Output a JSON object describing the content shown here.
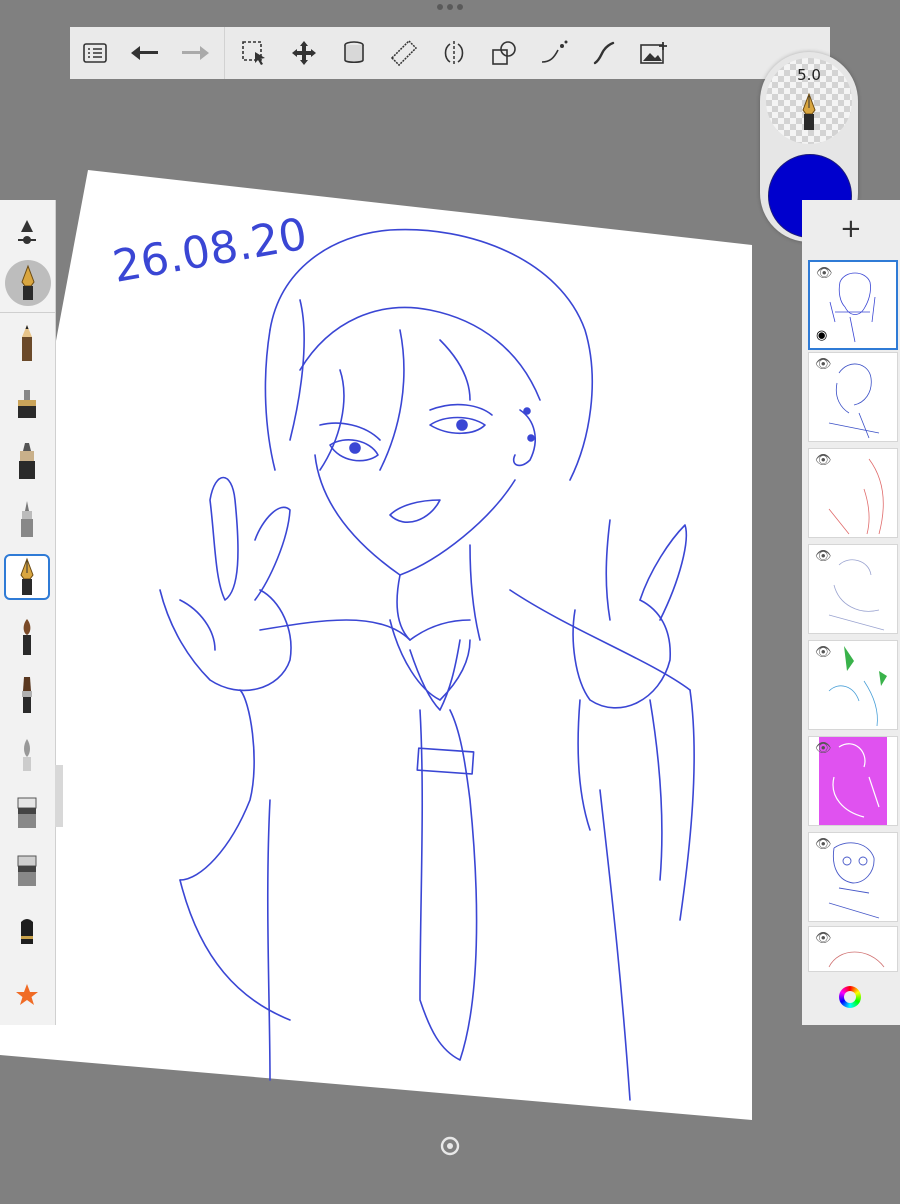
{
  "app": {
    "toolbar": {
      "items": [
        {
          "name": "list-menu-icon"
        },
        {
          "name": "undo-icon"
        },
        {
          "name": "redo-icon"
        },
        {
          "name": "selection-icon"
        },
        {
          "name": "transform-icon"
        },
        {
          "name": "fill-bucket-icon"
        },
        {
          "name": "ruler-icon"
        },
        {
          "name": "symmetry-icon"
        },
        {
          "name": "shape-icon"
        },
        {
          "name": "curve-icon"
        },
        {
          "name": "stroke-icon"
        },
        {
          "name": "add-image-icon"
        }
      ]
    },
    "brush_puck": {
      "size": "5.0",
      "color": "#0000cd"
    },
    "left_palette": {
      "tools": [
        {
          "name": "pencil-brush-icon"
        },
        {
          "name": "airbrush-icon"
        },
        {
          "name": "marker-icon"
        },
        {
          "name": "technical-pen-icon"
        },
        {
          "name": "ink-pen-icon",
          "selected": true
        },
        {
          "name": "paint-brush-icon"
        },
        {
          "name": "chisel-brush-icon"
        },
        {
          "name": "smudge-icon"
        },
        {
          "name": "eraser-icon"
        },
        {
          "name": "hard-eraser-icon"
        },
        {
          "name": "block-icon"
        },
        {
          "name": "favorites-star-icon"
        }
      ]
    },
    "layers": {
      "add_label": "+",
      "thumbnails": [
        {
          "name": "layer-1",
          "visible": true,
          "active": true,
          "accent": "#0000cd"
        },
        {
          "name": "layer-2",
          "visible": false,
          "accent": "#3a4fc6"
        },
        {
          "name": "layer-3",
          "visible": false,
          "accent": "#e06b6b"
        },
        {
          "name": "layer-4",
          "visible": false,
          "accent": "#9aa3d0"
        },
        {
          "name": "layer-5",
          "visible": false,
          "accent": "#39b24a"
        },
        {
          "name": "layer-6",
          "visible": false,
          "accent": "#e052f0"
        },
        {
          "name": "layer-7",
          "visible": false,
          "accent": "#4758c8"
        },
        {
          "name": "layer-8",
          "visible": false,
          "accent": "#d07070"
        }
      ]
    },
    "canvas": {
      "date_text": "26.08.20",
      "stroke_color": "#3a46d4"
    }
  }
}
